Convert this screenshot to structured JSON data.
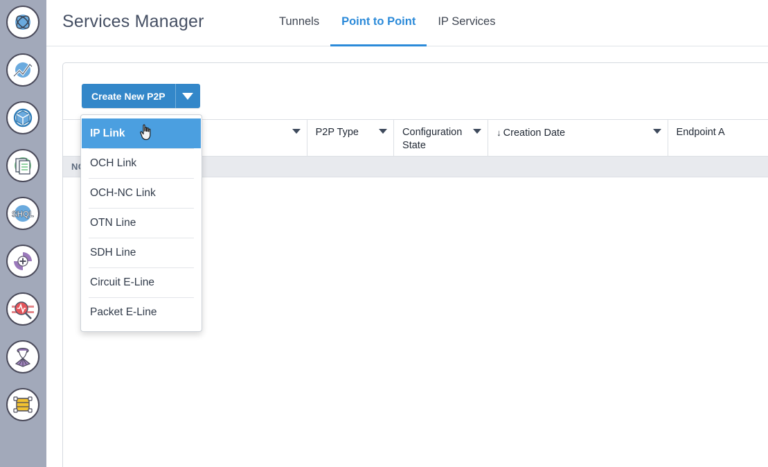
{
  "header": {
    "title": "Services Manager",
    "tabs": [
      {
        "label": "Tunnels",
        "active": false
      },
      {
        "label": "Point to Point",
        "active": true
      },
      {
        "label": "IP Services",
        "active": false
      }
    ]
  },
  "sidebar": {
    "background_color": "#a2a9ba",
    "items": [
      {
        "icon": "network-topology-icon",
        "color": "#6aaade"
      },
      {
        "icon": "performance-chart-icon",
        "color": "#6aaade"
      },
      {
        "icon": "inventory-cube-icon",
        "color": "#3a8fd0"
      },
      {
        "icon": "reports-document-icon",
        "color": "#77c68a"
      },
      {
        "icon": "shql-query-icon",
        "color": "#6aaade"
      },
      {
        "icon": "provisioning-add-icon",
        "color": "#9b79bb"
      },
      {
        "icon": "fault-monitor-search-icon",
        "color": "#e4545a"
      },
      {
        "icon": "service-deploy-icon",
        "color": "#8e6fae"
      },
      {
        "icon": "equipment-rack-icon",
        "color": "#f2c231"
      }
    ]
  },
  "toolbar": {
    "create_label": "Create New P2P",
    "caret_icon": "chevron-down-icon",
    "accent_color": "#3387c9"
  },
  "dropdown": {
    "open": true,
    "highlight_color": "#4b9fe0",
    "cursor_icon": "pointing-hand-cursor",
    "items": [
      {
        "label": "IP Link",
        "active": true
      },
      {
        "label": "OCH Link",
        "active": false
      },
      {
        "label": "OCH-NC Link",
        "active": false
      },
      {
        "label": "OTN Line",
        "active": false
      },
      {
        "label": "SDH Line",
        "active": false
      },
      {
        "label": "Circuit E-Line",
        "active": false
      },
      {
        "label": "Packet E-Line",
        "active": false
      }
    ]
  },
  "table": {
    "columns": [
      {
        "label": "",
        "caret": true,
        "sorted": false
      },
      {
        "label": "P2P Type",
        "caret": true,
        "sorted": false
      },
      {
        "label": "Configuration State",
        "caret": true,
        "sorted": false
      },
      {
        "label": "Creation Date",
        "caret": true,
        "sorted": true,
        "sort_icon": "↓"
      },
      {
        "label": "Endpoint A",
        "caret": false,
        "sorted": false
      }
    ],
    "filter_row": "NO MATCHING FILTERS",
    "rows": []
  }
}
